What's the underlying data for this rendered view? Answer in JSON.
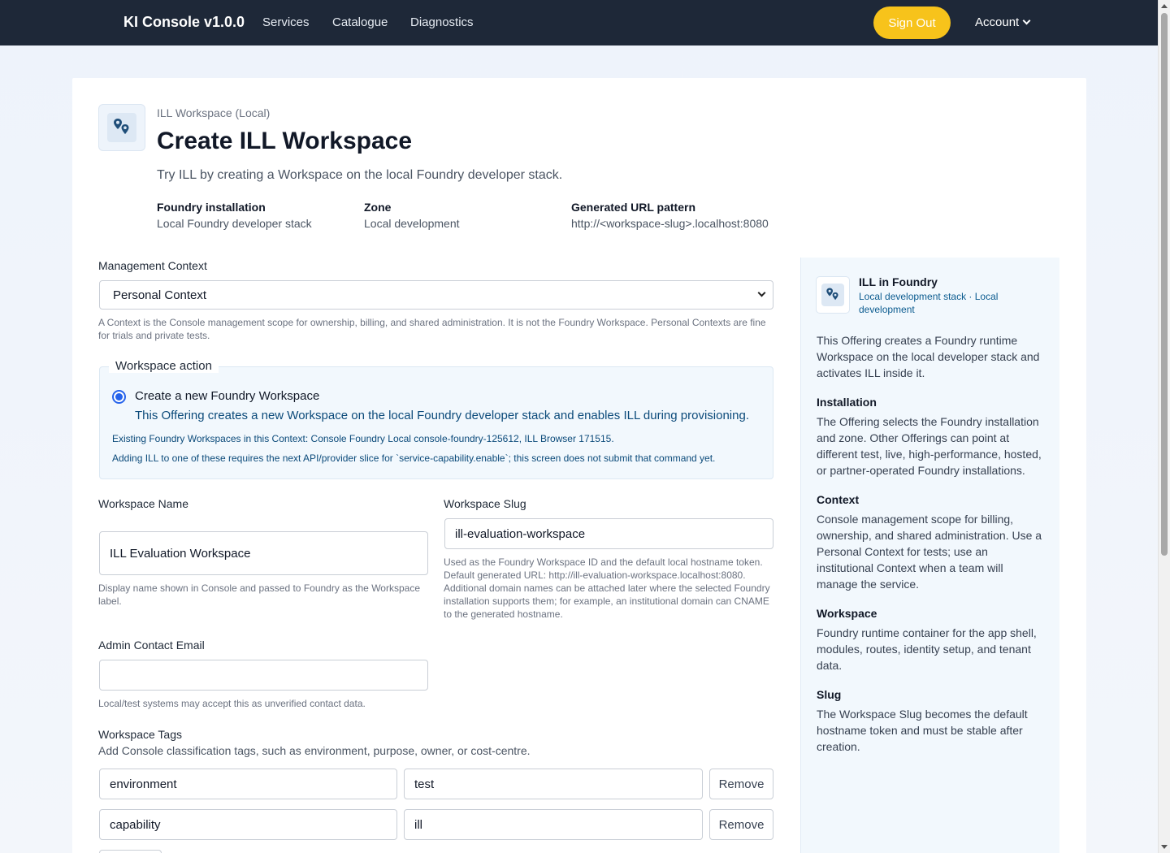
{
  "nav": {
    "brand": "KI Console v1.0.0",
    "links": [
      "Services",
      "Catalogue",
      "Diagnostics"
    ],
    "sign_out": "Sign Out",
    "account": "Account"
  },
  "header": {
    "eyebrow": "ILL Workspace (Local)",
    "title": "Create ILL Workspace",
    "subtitle": "Try ILL by creating a Workspace on the local Foundry developer stack.",
    "meta": [
      {
        "label": "Foundry installation",
        "value": "Local Foundry developer stack"
      },
      {
        "label": "Zone",
        "value": "Local development"
      },
      {
        "label": "Generated URL pattern",
        "value": "http://<workspace-slug>.localhost:8080"
      }
    ]
  },
  "form": {
    "context": {
      "label": "Management Context",
      "selected": "Personal Context",
      "help": "A Context is the Console management scope for ownership, billing, and shared administration. It is not the Foundry Workspace. Personal Contexts are fine for trials and private tests."
    },
    "action": {
      "legend": "Workspace action",
      "option_label": "Create a new Foundry Workspace",
      "option_desc": "This Offering creates a new Workspace on the local Foundry developer stack and enables ILL during provisioning.",
      "note1": "Existing Foundry Workspaces in this Context: Console Foundry Local console-foundry-125612, ILL Browser 171515.",
      "note2": "Adding ILL to one of these requires the next API/provider slice for `service-capability.enable`; this screen does not submit that command yet."
    },
    "name": {
      "label": "Workspace Name",
      "value": "ILL Evaluation Workspace",
      "help": "Display name shown in Console and passed to Foundry as the Workspace label."
    },
    "slug": {
      "label": "Workspace Slug",
      "value": "ill-evaluation-workspace",
      "help": "Used as the Foundry Workspace ID and the default local hostname token. Default generated URL: http://ill-evaluation-workspace.localhost:8080. Additional domain names can be attached later where the selected Foundry installation supports them; for example, an institutional domain can CNAME to the generated hostname."
    },
    "email": {
      "label": "Admin Contact Email",
      "value": "",
      "help": "Local/test systems may accept this as unverified contact data."
    },
    "tags": {
      "label": "Workspace Tags",
      "help": "Add Console classification tags, such as environment, purpose, owner, or cost-centre.",
      "remove_label": "Remove",
      "rows": [
        {
          "key": "environment",
          "value": "test"
        },
        {
          "key": "capability",
          "value": "ill"
        }
      ]
    }
  },
  "side": {
    "title": "ILL in Foundry",
    "subtitle": "Local development stack · Local development",
    "intro": "This Offering creates a Foundry runtime Workspace on the local developer stack and activates ILL inside it.",
    "sections": [
      {
        "heading": "Installation",
        "text": "The Offering selects the Foundry installation and zone. Other Offerings can point at different test, live, high-performance, hosted, or partner-operated Foundry installations."
      },
      {
        "heading": "Context",
        "text": "Console management scope for billing, ownership, and shared administration. Use a Personal Context for tests; use an institutional Context when a team will manage the service."
      },
      {
        "heading": "Workspace",
        "text": "Foundry runtime container for the app shell, modules, routes, identity setup, and tenant data."
      },
      {
        "heading": "Slug",
        "text": "The Workspace Slug becomes the default hostname token and must be stable after creation."
      }
    ]
  },
  "colors": {
    "navbar": "#1e2838",
    "accent": "#f7c31b",
    "info_text": "#0b4a7a",
    "panel_bg": "#f2f8fd"
  },
  "icons": [
    "map-pin-icon",
    "chevron-down-icon"
  ]
}
